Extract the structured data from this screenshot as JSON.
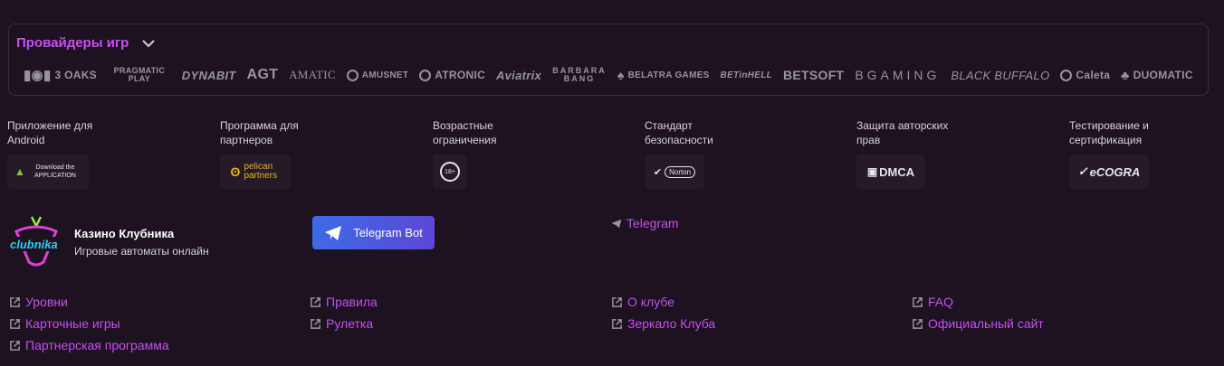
{
  "providers": {
    "title": "Провайдеры игр",
    "logos": [
      "3 OAKS",
      "PRAGMATIC PLAY",
      "DYNABIT",
      "AGT",
      "AMATIC",
      "AMUSNET",
      "ATRONIC",
      "Aviatrix",
      "BARBARA BANG",
      "BELATRA GAMES",
      "BETinHELL",
      "BETSOFT",
      "BGAMING",
      "BLACK BUFFALO",
      "Caleta",
      "DUOMATIC"
    ]
  },
  "badges": [
    {
      "label": "Приложение для Android",
      "logo": "Download the APPLICATION"
    },
    {
      "label": "Программа для партнеров",
      "logo": "pelican partners"
    },
    {
      "label": "Возрастные ограничения",
      "logo": "18+"
    },
    {
      "label": "Стандарт безопасности",
      "logo": "Norton"
    },
    {
      "label": "Защита авторских прав",
      "logo": "DMCA"
    },
    {
      "label": "Тестирование и сертификация",
      "logo": "eCOGRA"
    }
  ],
  "brand": {
    "logo_text": "clubnika",
    "name": "Казино Клубника",
    "tagline": "Игровые автоматы онлайн"
  },
  "telegram_bot": "Telegram Bot",
  "telegram_link": "Telegram",
  "links": {
    "levels": "Уровни",
    "card_games": "Карточные игры",
    "partner_program": "Партнерская программа",
    "rules": "Правила",
    "roulette": "Рулетка",
    "about": "О клубе",
    "mirror": "Зеркало Клуба",
    "faq": "FAQ",
    "official": "Официальный сайт"
  },
  "colors": {
    "accent": "#c94ff0",
    "background": "#1c1220",
    "button": "#4a5ee0"
  }
}
